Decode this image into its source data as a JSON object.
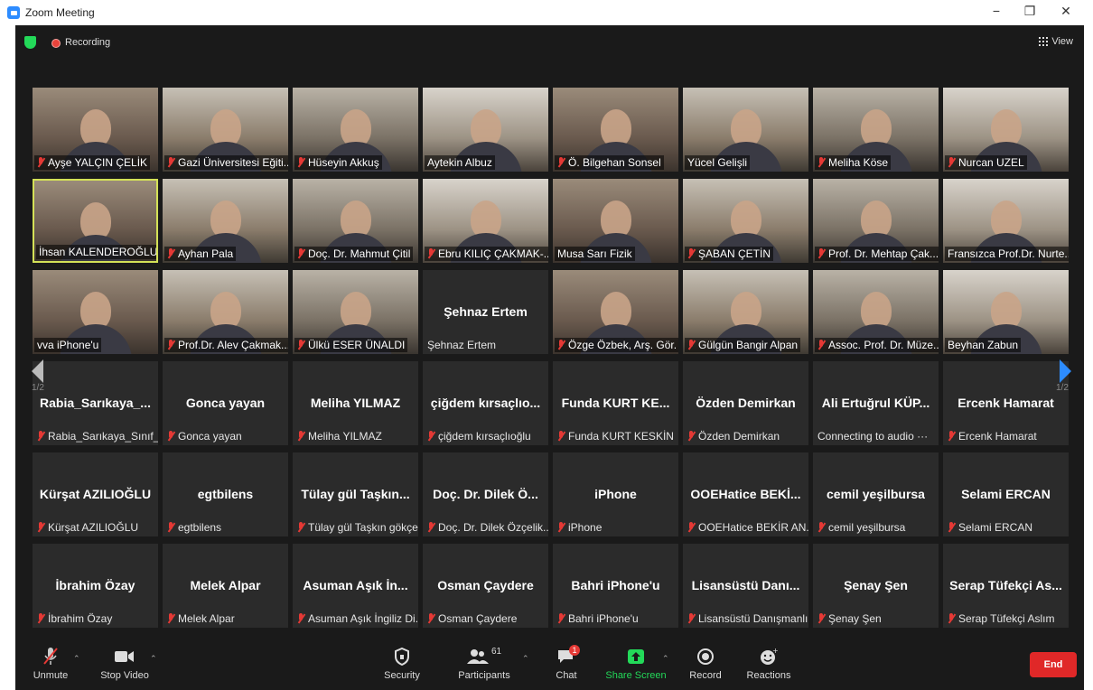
{
  "window": {
    "title": "Zoom Meeting",
    "controls": [
      "−",
      "❐",
      "✕"
    ]
  },
  "topbar": {
    "recording_label": "Recording",
    "view_label": "View"
  },
  "pagination": {
    "left_page": "1/2",
    "right_page": "1/2"
  },
  "participants": [
    {
      "name": "Ayşe YALÇIN ÇELİK",
      "video": true,
      "muted": true
    },
    {
      "name": "Gazi Üniversitesi Eğiti...",
      "video": true,
      "muted": true
    },
    {
      "name": "Hüseyin Akkuş",
      "video": true,
      "muted": true
    },
    {
      "name": "Aytekin Albuz",
      "video": true,
      "muted": false
    },
    {
      "name": "Ö. Bilgehan Sonsel",
      "video": true,
      "muted": true
    },
    {
      "name": "Yücel Gelişli",
      "video": true,
      "muted": false
    },
    {
      "name": "Meliha Köse",
      "video": true,
      "muted": true
    },
    {
      "name": "Nurcan UZEL",
      "video": true,
      "muted": true
    },
    {
      "name": "İhsan KALENDEROĞLU",
      "video": true,
      "muted": false,
      "active": true
    },
    {
      "name": "Ayhan Pala",
      "video": true,
      "muted": true
    },
    {
      "name": "Doç. Dr. Mahmut Çitil",
      "video": true,
      "muted": true
    },
    {
      "name": "Ebru KILIÇ ÇAKMAK-...",
      "video": true,
      "muted": true
    },
    {
      "name": "Musa Sarı Fizik",
      "video": true,
      "muted": false
    },
    {
      "name": "ŞABAN ÇETİN",
      "video": true,
      "muted": true
    },
    {
      "name": "Prof. Dr. Mehtap Çak...",
      "video": true,
      "muted": true
    },
    {
      "name": "Fransızca Prof.Dr. Nurte...",
      "video": true,
      "muted": false
    },
    {
      "name": "vva iPhone'u",
      "video": true,
      "muted": false
    },
    {
      "name": "Prof.Dr. Alev Çakmak...",
      "video": true,
      "muted": true
    },
    {
      "name": "Ülkü ESER ÜNALDI",
      "video": true,
      "muted": true
    },
    {
      "name": "Şehnaz Ertem",
      "video": false,
      "muted": false,
      "bigname": "Şehnaz Ertem"
    },
    {
      "name": "Özge Özbek, Arş. Gör.",
      "video": true,
      "muted": true
    },
    {
      "name": "Gülgün Bangir Alpan",
      "video": true,
      "muted": true
    },
    {
      "name": "Assoc. Prof. Dr. Müze...",
      "video": true,
      "muted": true
    },
    {
      "name": "Beyhan Zabun",
      "video": true,
      "muted": false
    },
    {
      "name": "Rabia_Sarıkaya_Sınıf_...",
      "video": false,
      "muted": true,
      "bigname": "Rabia_Sarıkaya_..."
    },
    {
      "name": "Gonca yayan",
      "video": false,
      "muted": true,
      "bigname": "Gonca yayan"
    },
    {
      "name": "Meliha YILMAZ",
      "video": false,
      "muted": true,
      "bigname": "Meliha YILMAZ"
    },
    {
      "name": "çiğdem kırsaçlıoğlu",
      "video": false,
      "muted": true,
      "bigname": "çiğdem kırsaçlıo..."
    },
    {
      "name": "Funda KURT KESKİN",
      "video": false,
      "muted": true,
      "bigname": "Funda KURT KE..."
    },
    {
      "name": "Özden Demirkan",
      "video": false,
      "muted": true,
      "bigname": "Özden Demirkan"
    },
    {
      "name": "Connecting to audio ···",
      "video": false,
      "muted": false,
      "bigname": "Ali Ertuğrul KÜP..."
    },
    {
      "name": "Ercenk Hamarat",
      "video": false,
      "muted": true,
      "bigname": "Ercenk Hamarat"
    },
    {
      "name": "Kürşat AZILIOĞLU",
      "video": false,
      "muted": true,
      "bigname": "Kürşat AZILIOĞLU"
    },
    {
      "name": "egtbilens",
      "video": false,
      "muted": true,
      "bigname": "egtbilens"
    },
    {
      "name": "Tülay gül Taşkın gökçe",
      "video": false,
      "muted": true,
      "bigname": "Tülay gül Taşkın..."
    },
    {
      "name": "Doç. Dr. Dilek Özçelik...",
      "video": false,
      "muted": true,
      "bigname": "Doç. Dr. Dilek Ö..."
    },
    {
      "name": "iPhone",
      "video": false,
      "muted": true,
      "bigname": "iPhone"
    },
    {
      "name": "OOEHatice BEKİR AN...",
      "video": false,
      "muted": true,
      "bigname": "OOEHatice BEKİ..."
    },
    {
      "name": "cemil yeşilbursa",
      "video": false,
      "muted": true,
      "bigname": "cemil yeşilbursa"
    },
    {
      "name": "Selami ERCAN",
      "video": false,
      "muted": true,
      "bigname": "Selami ERCAN"
    },
    {
      "name": "İbrahim Özay",
      "video": false,
      "muted": true,
      "bigname": "İbrahim Özay"
    },
    {
      "name": "Melek Alpar",
      "video": false,
      "muted": true,
      "bigname": "Melek Alpar"
    },
    {
      "name": "Asuman Aşık İngiliz Di...",
      "video": false,
      "muted": true,
      "bigname": "Asuman Aşık İn..."
    },
    {
      "name": "Osman Çaydere",
      "video": false,
      "muted": true,
      "bigname": "Osman Çaydere"
    },
    {
      "name": "Bahri iPhone'u",
      "video": false,
      "muted": true,
      "bigname": "Bahri iPhone'u"
    },
    {
      "name": "Lisansüstü Danışmanlı...",
      "video": false,
      "muted": true,
      "bigname": "Lisansüstü Danı..."
    },
    {
      "name": "Şenay Şen",
      "video": false,
      "muted": true,
      "bigname": "Şenay Şen"
    },
    {
      "name": "Serap Tüfekçi Aslım",
      "video": false,
      "muted": true,
      "bigname": "Serap Tüfekçi As..."
    }
  ],
  "toolbar": {
    "unmute": "Unmute",
    "stop_video": "Stop Video",
    "security": "Security",
    "participants": "Participants",
    "participants_count": "61",
    "chat": "Chat",
    "chat_badge": "1",
    "share_screen": "Share Screen",
    "record": "Record",
    "reactions": "Reactions",
    "end": "End"
  },
  "colors": {
    "accent": "#2D8CFF",
    "share": "#23d959",
    "end": "#e02828",
    "active_border": "#d4e157",
    "muted": "#e53935"
  }
}
